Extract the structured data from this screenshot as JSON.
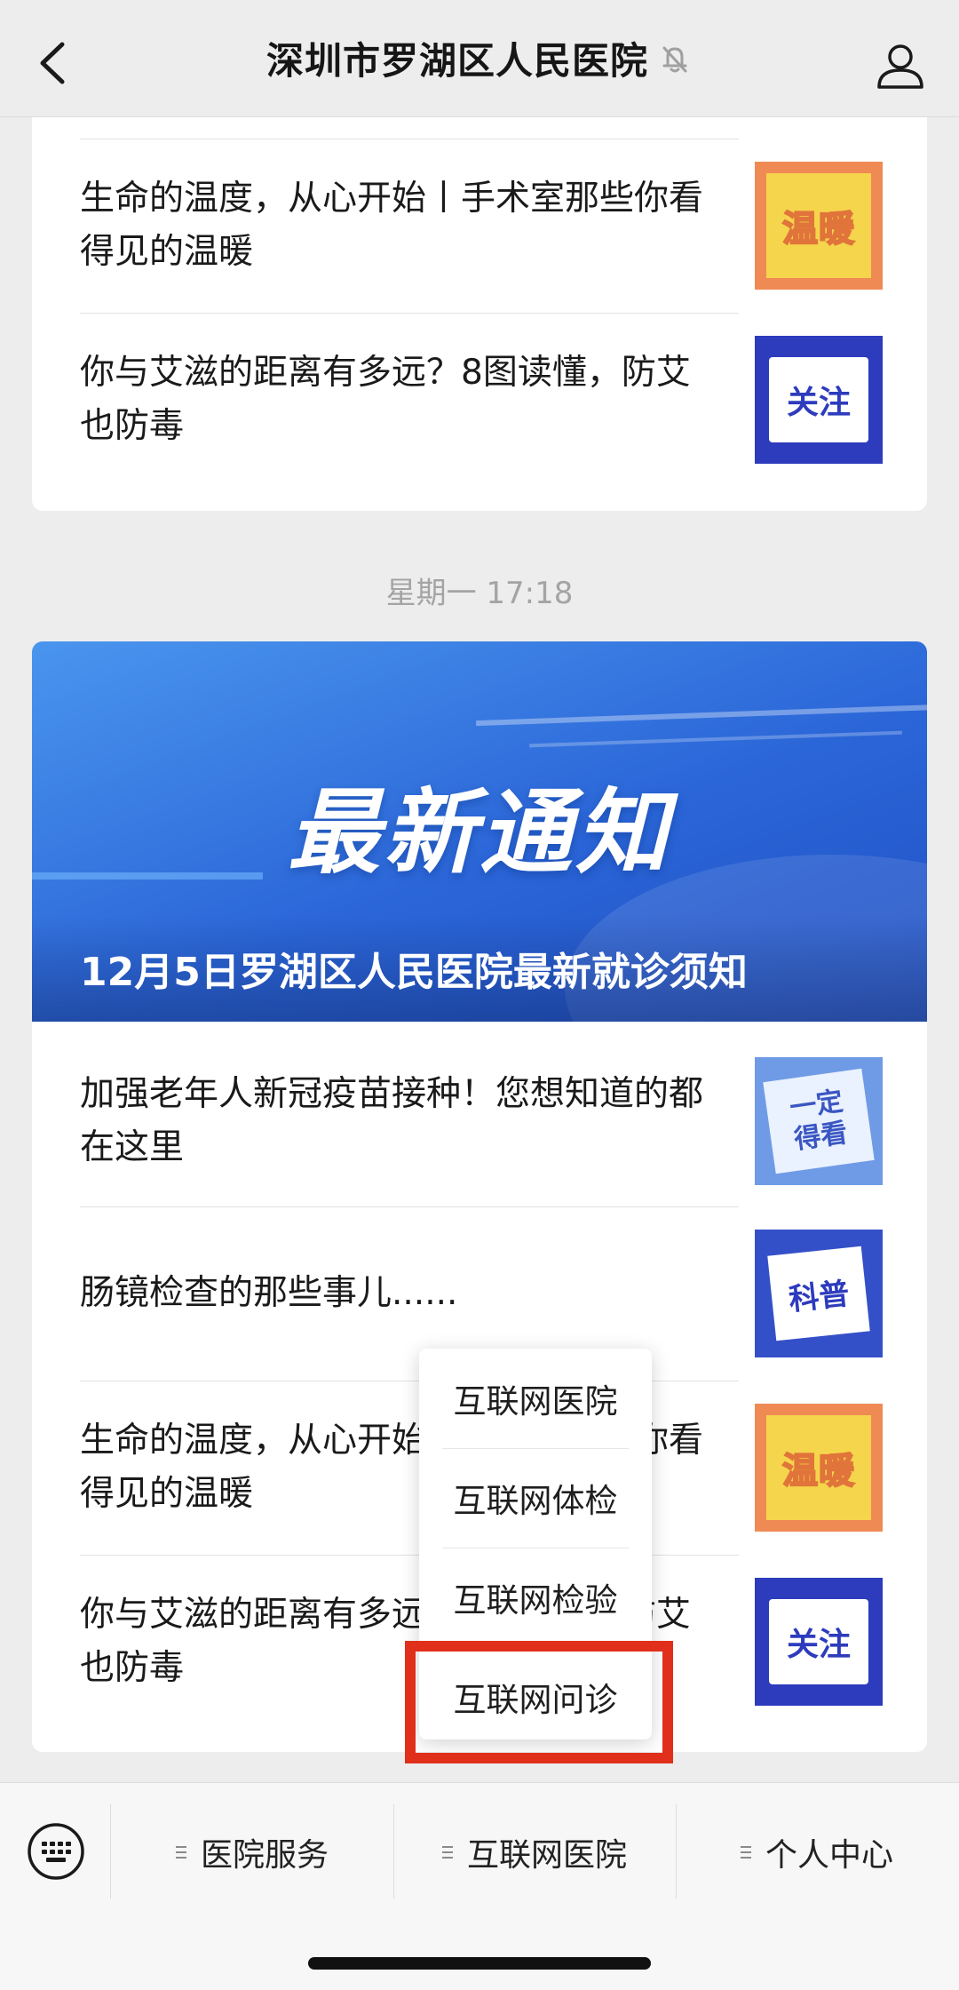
{
  "header": {
    "title": "深圳市罗湖区人民医院"
  },
  "top_card": {
    "articles": [
      {
        "title": "生命的温度，从心开始丨手术室那些你看得见的温暖",
        "thumb": "温暖"
      },
      {
        "title": "你与艾滋的距离有多远？8图读懂，防艾也防毒",
        "thumb": "关注"
      }
    ]
  },
  "timestamp": "星期一 17:18",
  "bottom_card": {
    "banner": {
      "big_text": "最新通知",
      "caption": "12月5日罗湖区人民医院最新就诊须知"
    },
    "articles": [
      {
        "title": "加强老年人新冠疫苗接种！您想知道的都在这里",
        "thumb": "一定\n得看"
      },
      {
        "title": "肠镜检查的那些事儿......",
        "thumb": "科普"
      },
      {
        "title": "生命的温度，从心开始丨手术室那些你看得见的温暖",
        "thumb": "温暖"
      },
      {
        "title": "你与艾滋的距离有多远？8图读懂，防艾也防毒",
        "thumb": "关注"
      }
    ]
  },
  "popup_menu": {
    "items": [
      "互联网医院",
      "互联网体检",
      "互联网检验",
      "互联网问诊"
    ],
    "highlighted": "互联网问诊"
  },
  "bottom_menu": {
    "items": [
      "医院服务",
      "互联网医院",
      "个人中心"
    ]
  },
  "colors": {
    "highlight": "#e0301c",
    "banner": "#2b66d8"
  }
}
